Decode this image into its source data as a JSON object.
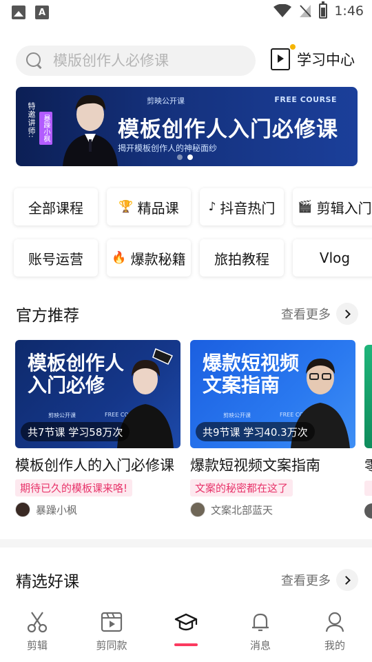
{
  "status_bar": {
    "time": "1:46",
    "battery_level": 0.7
  },
  "search": {
    "placeholder": "模版创作人必修课"
  },
  "learning_center": {
    "label": "学习中心"
  },
  "banner": {
    "side_text": "特邀讲师:",
    "instructor_tag": "暴躁小枫",
    "brand": "剪映公开课",
    "free_label": "FREE COURSE",
    "title": "模板创作人入门必修课",
    "subtitle": "揭开模板创作人的神秘面纱",
    "page_count": 2,
    "active_page": 2
  },
  "categories": [
    {
      "label": "全部课程",
      "icon": ""
    },
    {
      "label": "精品课",
      "icon": "🏆"
    },
    {
      "label": "抖音热门",
      "icon": "♪"
    },
    {
      "label": "剪辑入门",
      "icon": "🎬"
    },
    {
      "label": "账号运营",
      "icon": ""
    },
    {
      "label": "爆款秘籍",
      "icon": "🔥"
    },
    {
      "label": "旅拍教程",
      "icon": ""
    },
    {
      "label": "Vlog",
      "icon": ""
    }
  ],
  "official_section": {
    "title": "官方推荐",
    "more_label": "查看更多"
  },
  "courses": [
    {
      "thumb_title_line1": "模板创作人",
      "thumb_title_line2": "入门必修",
      "thumb_brand": "剪映公开课",
      "thumb_free": "FREE COURSE",
      "stats": "共7节课 学习58万次",
      "name": "模板创作人的入门必修课",
      "tag": "期待已久的模板课来咯!",
      "author": "暴躁小枫"
    },
    {
      "thumb_title_line1": "爆款短视频",
      "thumb_title_line2": "文案指南",
      "thumb_brand": "剪映公开课",
      "thumb_free": "FREE COURSE",
      "stats": "共9节课 学习40.3万次",
      "name": "爆款短视频文案指南",
      "tag": "文案的秘密都在这了",
      "author": "文案北部蓝天"
    }
  ],
  "peek_course": {
    "name_fragment": "零"
  },
  "featured_section": {
    "title": "精选好课",
    "more_label": "查看更多"
  },
  "bottom_nav": {
    "items": [
      {
        "label": "剪辑",
        "icon": "scissors-icon"
      },
      {
        "label": "剪同款",
        "icon": "clapperboard-icon"
      },
      {
        "label": "",
        "icon": "graduation-cap-icon",
        "active": true
      },
      {
        "label": "消息",
        "icon": "bell-icon"
      },
      {
        "label": "我的",
        "icon": "person-icon"
      }
    ]
  },
  "colors": {
    "accent": "#fb3a5f",
    "tag_text": "#e8336a",
    "tag_bg": "#fde9ef",
    "banner_bg": "#14307a"
  }
}
